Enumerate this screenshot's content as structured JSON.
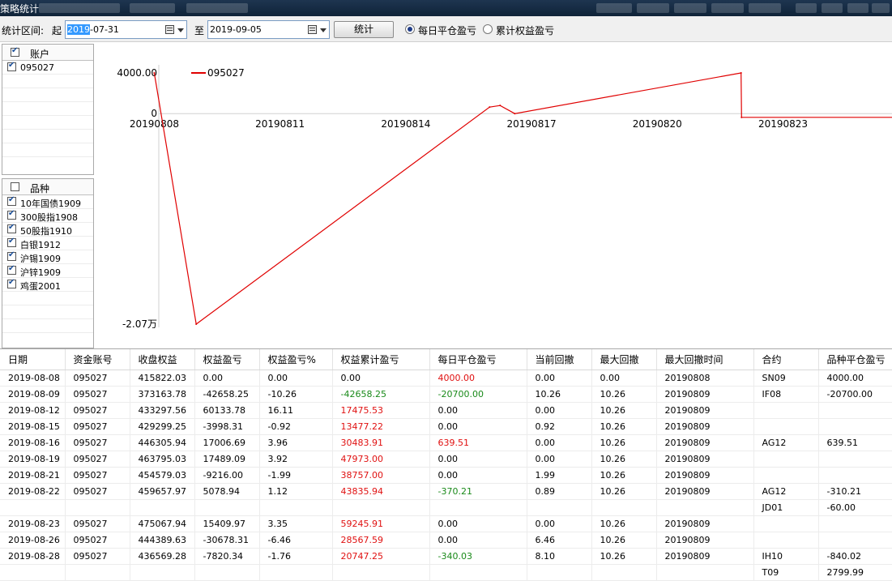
{
  "window": {
    "title": "策略统计"
  },
  "toolbar": {
    "range_label": "统计区间:",
    "start_label": "起",
    "start_date_highlight": "2019",
    "start_date_rest": "-07-31",
    "to_label": "至",
    "end_date": "2019-09-05",
    "stat_button": "统计",
    "radio_daily": "每日平仓盈亏",
    "radio_cumulative": "累计权益盈亏",
    "selected": "daily"
  },
  "accounts_panel": {
    "header": "账户",
    "header_checked": true,
    "items": [
      {
        "label": "095027",
        "checked": true
      }
    ]
  },
  "varieties_panel": {
    "header": "品种",
    "header_checked": false,
    "items": [
      {
        "label": "10年国债1909",
        "checked": true
      },
      {
        "label": "300股指1908",
        "checked": true
      },
      {
        "label": "50股指1910",
        "checked": true
      },
      {
        "label": "白银1912",
        "checked": true
      },
      {
        "label": "沪锡1909",
        "checked": true
      },
      {
        "label": "沪锌1909",
        "checked": true
      },
      {
        "label": "鸡蛋2001",
        "checked": true
      }
    ]
  },
  "chart_data": {
    "type": "line",
    "y_tick_labels": [
      "4000.00",
      "0",
      "-2.07万"
    ],
    "y_ticks": [
      4000,
      0,
      -20700
    ],
    "ylim": [
      -20700,
      4000
    ],
    "x_tick_labels": [
      "20190808",
      "20190811",
      "20190814",
      "20190817",
      "20190820",
      "20190823"
    ],
    "x_ticks": [
      8,
      11,
      14,
      17,
      20,
      23
    ],
    "xlim": [
      6.6,
      25.6
    ],
    "legend": "top-left",
    "series": [
      {
        "name": "095027",
        "color": "#e00000",
        "x": [
          8,
          9,
          16,
          16.25,
          16.6,
          22,
          22.01
        ],
        "y": [
          4000,
          -20700,
          639.51,
          800,
          0,
          4000,
          -370.21
        ]
      }
    ],
    "tail_y": -370.21
  },
  "table": {
    "columns": [
      "日期",
      "资金账号",
      "收盘权益",
      "权益盈亏",
      "权益盈亏%",
      "权益累计盈亏",
      "每日平仓盈亏",
      "当前回撤",
      "最大回撤",
      "最大回撤时间",
      "合约",
      "品种平仓盈亏"
    ],
    "rows": [
      {
        "cells": [
          "2019-08-08",
          "095027",
          "415822.03",
          "0.00",
          "0.00",
          "0.00",
          "4000.00",
          "0.00",
          "0.00",
          "20190808",
          "SN09",
          "4000.00"
        ],
        "c5": "",
        "c6": "red"
      },
      {
        "cells": [
          "2019-08-09",
          "095027",
          "373163.78",
          "-42658.25",
          "-10.26",
          "-42658.25",
          "-20700.00",
          "10.26",
          "10.26",
          "20190809",
          "IF08",
          "-20700.00"
        ],
        "c5": "green",
        "c6": "green"
      },
      {
        "cells": [
          "2019-08-12",
          "095027",
          "433297.56",
          "60133.78",
          "16.11",
          "17475.53",
          "0.00",
          "0.00",
          "10.26",
          "20190809",
          "",
          ""
        ],
        "c5": "red",
        "c6": ""
      },
      {
        "cells": [
          "2019-08-15",
          "095027",
          "429299.25",
          "-3998.31",
          "-0.92",
          "13477.22",
          "0.00",
          "0.92",
          "10.26",
          "20190809",
          "",
          ""
        ],
        "c5": "red",
        "c6": ""
      },
      {
        "cells": [
          "2019-08-16",
          "095027",
          "446305.94",
          "17006.69",
          "3.96",
          "30483.91",
          "639.51",
          "0.00",
          "10.26",
          "20190809",
          "AG12",
          "639.51"
        ],
        "c5": "red",
        "c6": "red"
      },
      {
        "cells": [
          "2019-08-19",
          "095027",
          "463795.03",
          "17489.09",
          "3.92",
          "47973.00",
          "0.00",
          "0.00",
          "10.26",
          "20190809",
          "",
          ""
        ],
        "c5": "red",
        "c6": ""
      },
      {
        "cells": [
          "2019-08-21",
          "095027",
          "454579.03",
          "-9216.00",
          "-1.99",
          "38757.00",
          "0.00",
          "1.99",
          "10.26",
          "20190809",
          "",
          ""
        ],
        "c5": "red",
        "c6": ""
      },
      {
        "cells": [
          "2019-08-22",
          "095027",
          "459657.97",
          "5078.94",
          "1.12",
          "43835.94",
          "-370.21",
          "0.89",
          "10.26",
          "20190809",
          "AG12",
          "-310.21"
        ],
        "c5": "red",
        "c6": "green"
      },
      {
        "cells": [
          "",
          "",
          "",
          "",
          "",
          "",
          "",
          "",
          "",
          "",
          "JD01",
          "-60.00"
        ],
        "c5": "",
        "c6": ""
      },
      {
        "cells": [
          "2019-08-23",
          "095027",
          "475067.94",
          "15409.97",
          "3.35",
          "59245.91",
          "0.00",
          "0.00",
          "10.26",
          "20190809",
          "",
          ""
        ],
        "c5": "red",
        "c6": ""
      },
      {
        "cells": [
          "2019-08-26",
          "095027",
          "444389.63",
          "-30678.31",
          "-6.46",
          "28567.59",
          "0.00",
          "6.46",
          "10.26",
          "20190809",
          "",
          ""
        ],
        "c5": "red",
        "c6": ""
      },
      {
        "cells": [
          "2019-08-28",
          "095027",
          "436569.28",
          "-7820.34",
          "-1.76",
          "20747.25",
          "-340.03",
          "8.10",
          "10.26",
          "20190809",
          "IH10",
          "-840.02"
        ],
        "c5": "red",
        "c6": "green"
      },
      {
        "cells": [
          "",
          "",
          "",
          "",
          "",
          "",
          "",
          "",
          "",
          "",
          "T09",
          "2799.99"
        ],
        "c5": "",
        "c6": ""
      }
    ]
  }
}
